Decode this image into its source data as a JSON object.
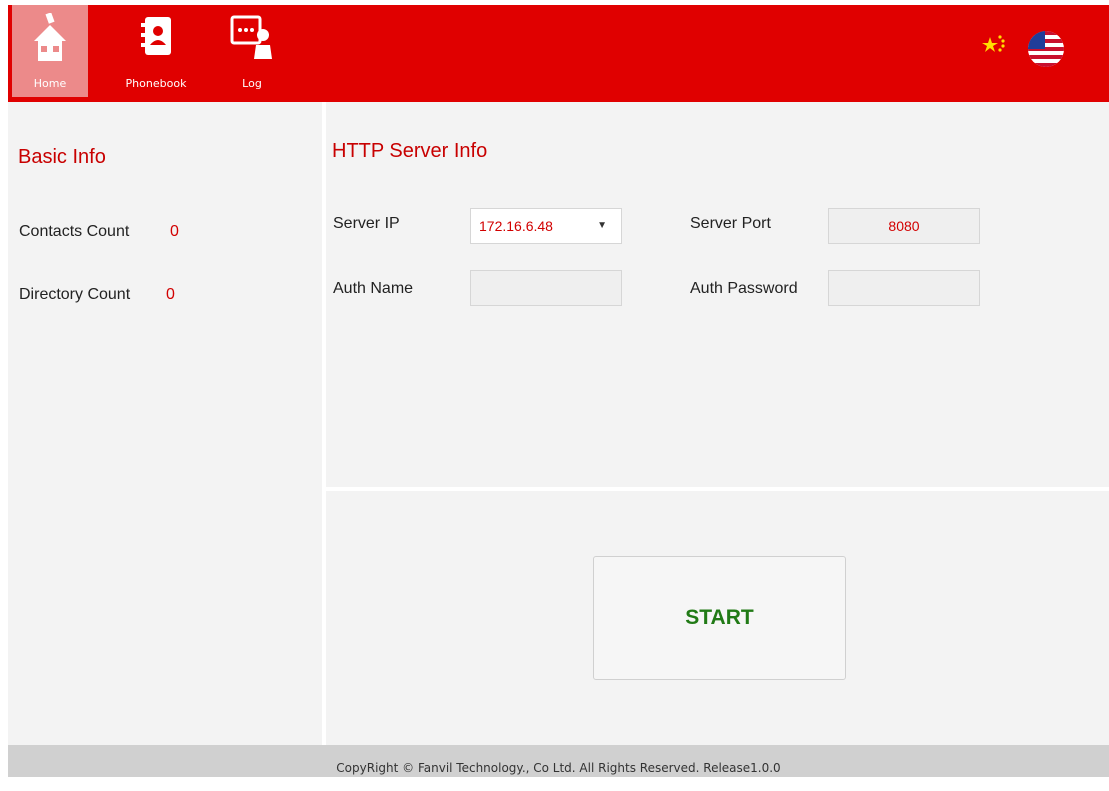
{
  "nav": {
    "items": [
      {
        "label": "Home",
        "icon": "home-icon",
        "active": true
      },
      {
        "label": "Phonebook",
        "icon": "phonebook-icon",
        "active": false
      },
      {
        "label": "Log",
        "icon": "log-icon",
        "active": false
      }
    ],
    "languages": [
      "chinese-flag-icon",
      "us-flag-icon"
    ]
  },
  "basic_info": {
    "title": "Basic Info",
    "contacts_count_label": "Contacts Count",
    "contacts_count": "0",
    "directory_count_label": "Directory Count",
    "directory_count": "0"
  },
  "http_server": {
    "title": "HTTP Server Info",
    "server_ip_label": "Server IP",
    "server_ip": "172.16.6.48",
    "server_port_label": "Server Port",
    "server_port": "8080",
    "auth_name_label": "Auth Name",
    "auth_name": "",
    "auth_password_label": "Auth Password",
    "auth_password": ""
  },
  "action": {
    "start_label": "START"
  },
  "footer": {
    "text": "CopyRight © Fanvil Technology., Co Ltd. All Rights Reserved.   Release1.0.0"
  },
  "colors": {
    "brand_red": "#e00000",
    "accent_text": "#c80000",
    "start_green": "#217a16"
  }
}
